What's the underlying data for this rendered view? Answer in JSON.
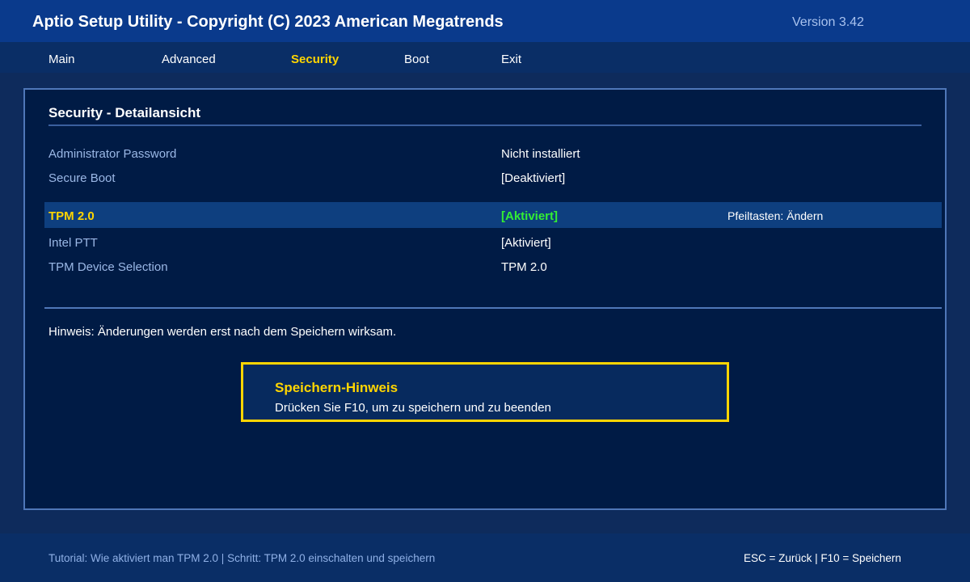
{
  "header": {
    "title": "Aptio Setup Utility - Copyright (C) 2023 American Megatrends",
    "version": "Version 3.42"
  },
  "menu": {
    "items": [
      {
        "label": "Main"
      },
      {
        "label": "Advanced"
      },
      {
        "label": "Security",
        "active": true
      },
      {
        "label": "Boot"
      },
      {
        "label": "Exit"
      }
    ]
  },
  "section": {
    "title": "Security - Detailansicht"
  },
  "settings": {
    "admin_password": {
      "label": "Administrator Password",
      "value": "Nicht installiert"
    },
    "secure_boot": {
      "label": "Secure Boot",
      "value": "[Deaktiviert]"
    },
    "tpm": {
      "label": "TPM 2.0",
      "value": "[Aktiviert]",
      "hint": "Pfeiltasten: Ändern"
    },
    "intel_ptt": {
      "label": "Intel PTT",
      "value": "[Aktiviert]"
    },
    "tpm_device": {
      "label": "TPM Device Selection",
      "value": "TPM 2.0"
    }
  },
  "note": "Hinweis: Änderungen werden erst nach dem Speichern wirksam.",
  "save_hint": {
    "heading": "Speichern-Hinweis",
    "body": "Drücken Sie F10, um zu speichern und zu beenden"
  },
  "status": {
    "tutorial": "Tutorial: Wie aktiviert man TPM 2.0 | Schritt: TPM 2.0 einschalten und speichern",
    "keys": "ESC = Zurück | F10 = Speichern"
  },
  "colors": {
    "title_bar": "#0a3a8c",
    "menu_bar": "#0a2e66",
    "panel": "#001b45",
    "accent_yellow": "#ffd500",
    "enabled_green": "#33ee33",
    "label_blue": "#9bb8e6"
  }
}
